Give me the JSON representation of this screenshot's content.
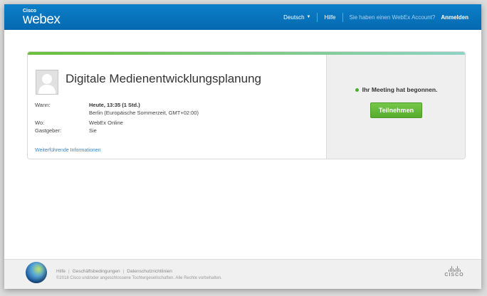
{
  "header": {
    "logo_small": "Cisco",
    "logo_main": "webex",
    "language": "Deutsch",
    "help": "Hilfe",
    "account_prompt": "Sie haben einen WebEx Account?",
    "login": "Anmelden"
  },
  "meeting": {
    "title": "Digitale Medienentwicklungsplanung",
    "details": [
      {
        "label": "Wann:",
        "value": "Heute, 13:35  (1 Std.)",
        "value2": "Berlin (Europäische Sommerzeit, GMT+02:00)"
      },
      {
        "label": "Wo:",
        "value": "WebEx Online"
      },
      {
        "label": "Gastgeber:",
        "value": "Sie"
      }
    ],
    "more_info_link": "Weiterführende Informationen",
    "status": "Ihr Meeting hat begonnen.",
    "join_button": "Teilnehmen"
  },
  "footer": {
    "links": [
      "Hilfe",
      "Geschäftsbedingungen",
      "Datenschutzrichtlinien"
    ],
    "copyright": "©2018 Cisco und/oder angeschlossene Tochtergesellschaften. Alle Rechte vorbehalten.",
    "brand": "CISCO"
  },
  "colors": {
    "topbar": "#0b7fc9",
    "accent_green": "#5cb531",
    "link_blue": "#3a86c0"
  }
}
